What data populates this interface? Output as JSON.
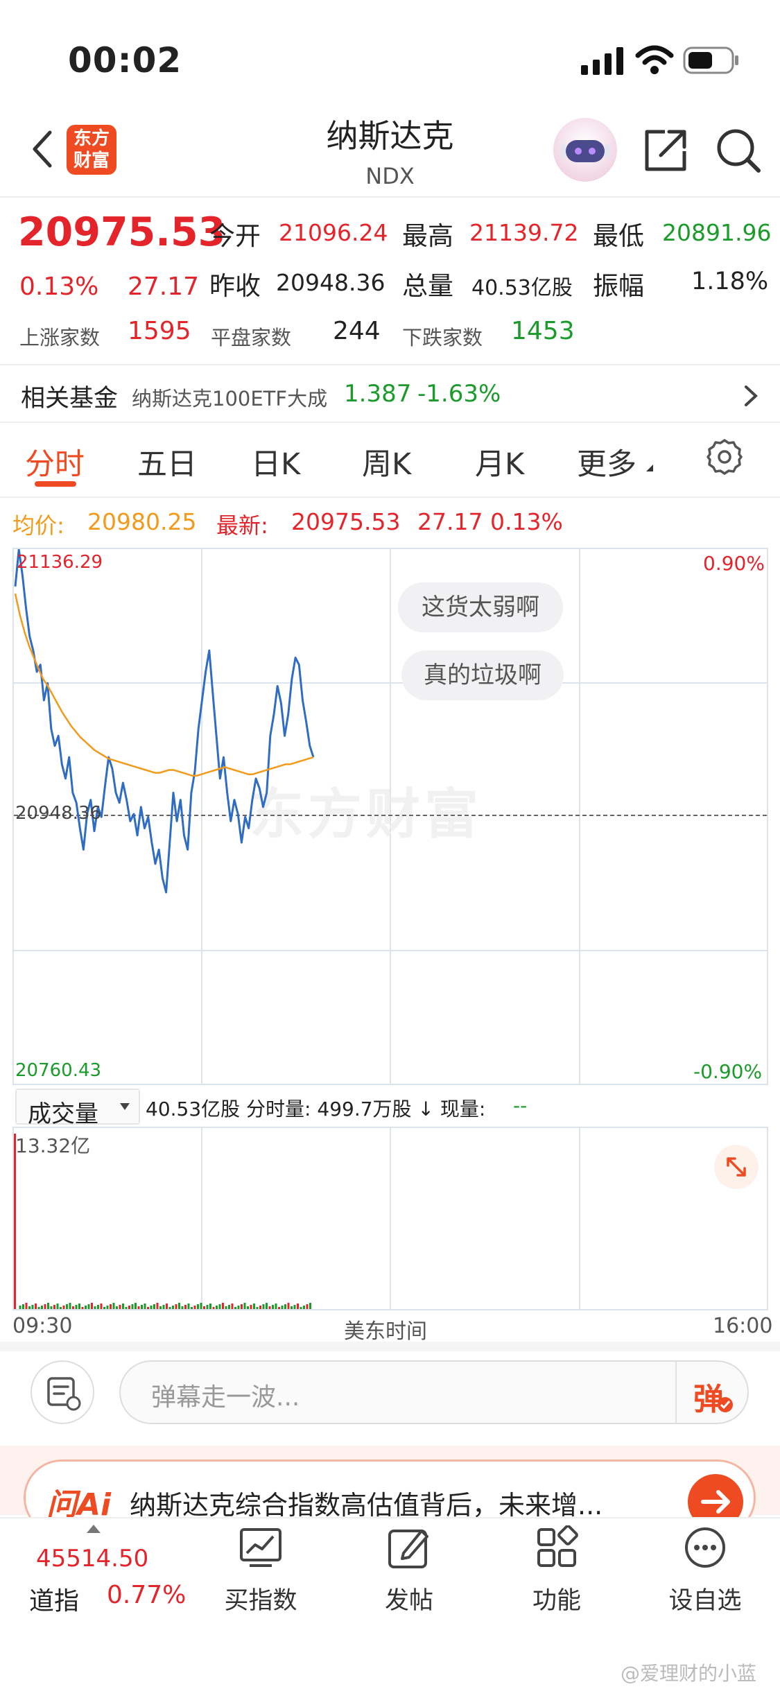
{
  "status": {
    "time": "00:02"
  },
  "header": {
    "title": "纳斯达克",
    "subtitle": "NDX",
    "brand_line1": "东方",
    "brand_line2": "财富"
  },
  "quote": {
    "price": "20975.53",
    "pct": "0.13%",
    "change": "27.17",
    "open_label": "今开",
    "open": "21096.24",
    "high_label": "最高",
    "high": "21139.72",
    "low_label": "最低",
    "low": "20891.96",
    "prev_label": "昨收",
    "prev": "20948.36",
    "vol_label": "总量",
    "vol": "40.53亿股",
    "amp_label": "振幅",
    "amp": "1.18%",
    "up_label": "上涨家数",
    "up": "1595",
    "flat_label": "平盘家数",
    "flat": "244",
    "down_label": "下跌家数",
    "down": "1453"
  },
  "fund": {
    "label": "相关基金",
    "name": "纳斯达克100ETF大成",
    "price": "1.387",
    "pct": "-1.63%"
  },
  "tabs": [
    "分时",
    "五日",
    "日K",
    "周K",
    "月K",
    "更多"
  ],
  "chart_info": {
    "avg_label": "均价:",
    "avg": "20980.25",
    "last_label": "最新:",
    "last": "20975.53",
    "change": "27.17",
    "pct": "0.13%"
  },
  "chart_data": {
    "type": "line",
    "y_max_label": "21136.29",
    "y_min_label": "20760.43",
    "y_ref_label": "20948.36",
    "pct_max_label": "0.90%",
    "pct_min_label": "-0.90%",
    "ylim": [
      20760.43,
      21136.29
    ],
    "x_start_label": "09:30",
    "x_mid_label": "美东时间",
    "x_end_label": "16:00",
    "watermark": "东方财富",
    "series": [
      {
        "values": [
          21110,
          21136,
          21118,
          21095,
          21075,
          21065,
          21050,
          21055,
          21030,
          21042,
          21010,
          20998,
          21005,
          20985,
          20975,
          20990,
          20965,
          20958,
          20940,
          20925,
          20950,
          20960,
          20938,
          20955,
          20948,
          20970,
          20990,
          20982,
          20965,
          20958,
          20972,
          20960,
          20945,
          20950,
          20935,
          20955,
          20940,
          20948,
          20930,
          20915,
          20925,
          20905,
          20895,
          20930,
          20965,
          20945,
          20960,
          20935,
          20925,
          20965,
          20980,
          21010,
          21030,
          21050,
          21065,
          21035,
          21005,
          20975,
          20990,
          20965,
          20945,
          20960,
          20950,
          20930,
          20948,
          20940,
          20960,
          20975,
          20968,
          20955,
          20965,
          21005,
          21020,
          21040,
          21028,
          21005,
          21020,
          21045,
          21060,
          21055,
          21030,
          21015,
          20998,
          20990
        ]
      },
      {
        "values": [
          21105,
          21090,
          21078,
          21068,
          21060,
          21052,
          21045,
          21040,
          21034,
          21028,
          21022,
          21017,
          21012,
          21008,
          21004,
          21001,
          20998,
          20995,
          20993,
          20991,
          20989,
          20988,
          20987,
          20986,
          20985,
          20984,
          20983,
          20982,
          20981,
          20980,
          20979,
          20979,
          20980,
          20981,
          20981,
          20980,
          20979,
          20978,
          20977,
          20977,
          20978,
          20979,
          20980,
          20981,
          20982,
          20983,
          20982,
          20981,
          20980,
          20979,
          20978,
          20978,
          20979,
          20980,
          20981,
          20982,
          20983,
          20984,
          20985,
          20985,
          20986,
          20987,
          20988,
          20989,
          20990
        ]
      }
    ],
    "volume_max_label": "13.32亿"
  },
  "volume_bar": {
    "selector": "成交量",
    "text": "40.53亿股 分时量: 499.7万股 ↓ 现量:",
    "current": "--"
  },
  "danmu": {
    "bubble1": "这货太弱啊",
    "bubble2": "真的垃圾啊",
    "input_placeholder": "弹幕走一波...",
    "send": "弹"
  },
  "ai_banner": {
    "logo": "问Ai",
    "text": "纳斯达克综合指数高估值背后，未来增..."
  },
  "bottom": {
    "index_value": "45514.50",
    "index_name": "道指",
    "index_pct": "0.77%",
    "buy": "买指数",
    "post": "发帖",
    "func": "功能",
    "watch": "设自选"
  },
  "watermark_text": "@爱理财的小蓝"
}
